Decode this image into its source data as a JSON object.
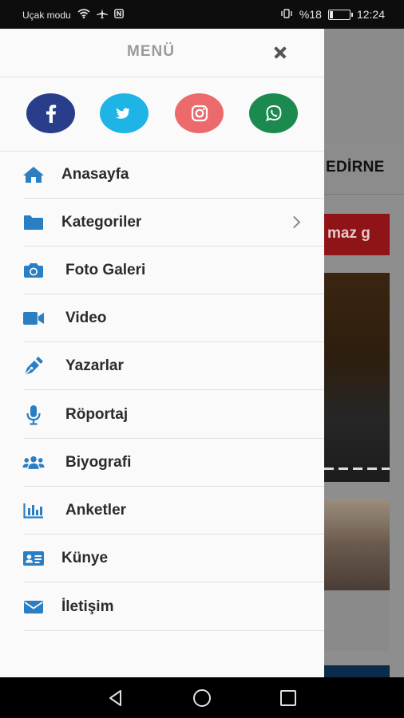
{
  "status": {
    "carrier": "Uçak modu",
    "battery": "%18",
    "battery_level": 0.18,
    "time": "12:24"
  },
  "drawer": {
    "title": "MENÜ",
    "social": [
      {
        "name": "facebook",
        "color": "#283e8a"
      },
      {
        "name": "twitter",
        "color": "#1eb4e6"
      },
      {
        "name": "instagram",
        "color": "#ec6a6c"
      },
      {
        "name": "whatsapp",
        "color": "#1b8a4e"
      }
    ],
    "items": [
      {
        "label": "Anasayfa",
        "icon": "home-icon"
      },
      {
        "label": "Kategoriler",
        "icon": "folder-icon",
        "has_chevron": true
      },
      {
        "label": "Foto Galeri",
        "icon": "camera-icon"
      },
      {
        "label": "Video",
        "icon": "video-icon"
      },
      {
        "label": "Yazarlar",
        "icon": "pen-icon"
      },
      {
        "label": "Röportaj",
        "icon": "microphone-icon"
      },
      {
        "label": "Biyografi",
        "icon": "users-icon"
      },
      {
        "label": "Anketler",
        "icon": "poll-chart-icon"
      },
      {
        "label": "Künye",
        "icon": "id-card-icon"
      },
      {
        "label": "İletişim",
        "icon": "envelope-icon"
      }
    ]
  },
  "background": {
    "city": "EDİRNE",
    "ad_text": "maz g"
  },
  "colors": {
    "icon_blue": "#2a7fc4",
    "text": "#2b2b2b",
    "title_gray": "#9a9a9a"
  }
}
